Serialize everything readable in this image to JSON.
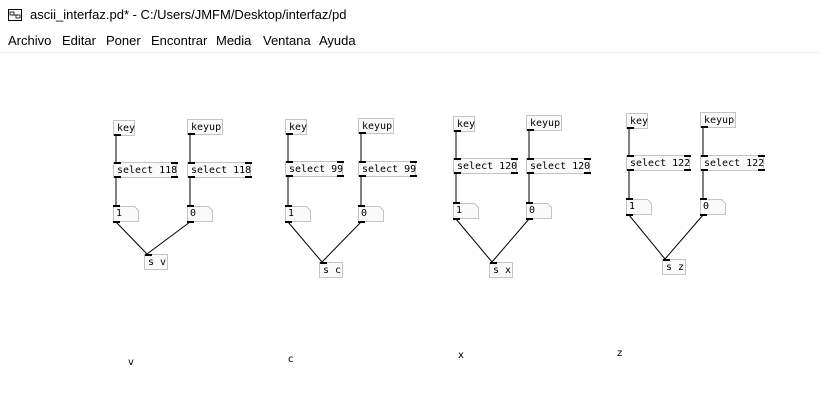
{
  "window": {
    "title": "ascii_interfaz.pd* - C:/Users/JMFM/Desktop/interfaz/pd",
    "icon": "pd-app-icon"
  },
  "menu": {
    "items": [
      "Archivo",
      "Editar",
      "Poner",
      "Encontrar",
      "Media",
      "Ventana",
      "Ayuda"
    ]
  },
  "patch": {
    "groups": [
      {
        "key_label": "key",
        "keyup_label": "keyup",
        "select_key_label": "select 118",
        "select_keyup_label": "select 118",
        "num_key_value": "1",
        "num_keyup_value": "0",
        "send_label": "s v",
        "comment": "v"
      },
      {
        "key_label": "key",
        "keyup_label": "keyup",
        "select_key_label": "select 99",
        "select_keyup_label": "select 99",
        "num_key_value": "1",
        "num_keyup_value": "0",
        "send_label": "s c",
        "comment": "c"
      },
      {
        "key_label": "key",
        "keyup_label": "keyup",
        "select_key_label": "select 120",
        "select_keyup_label": "select 120",
        "num_key_value": "1",
        "num_keyup_value": "0",
        "send_label": "s x",
        "comment": "x"
      },
      {
        "key_label": "key",
        "keyup_label": "keyup",
        "select_key_label": "select 122",
        "select_keyup_label": "select 122",
        "num_key_value": "1",
        "num_keyup_value": "0",
        "send_label": "s z",
        "comment": "z"
      }
    ]
  }
}
